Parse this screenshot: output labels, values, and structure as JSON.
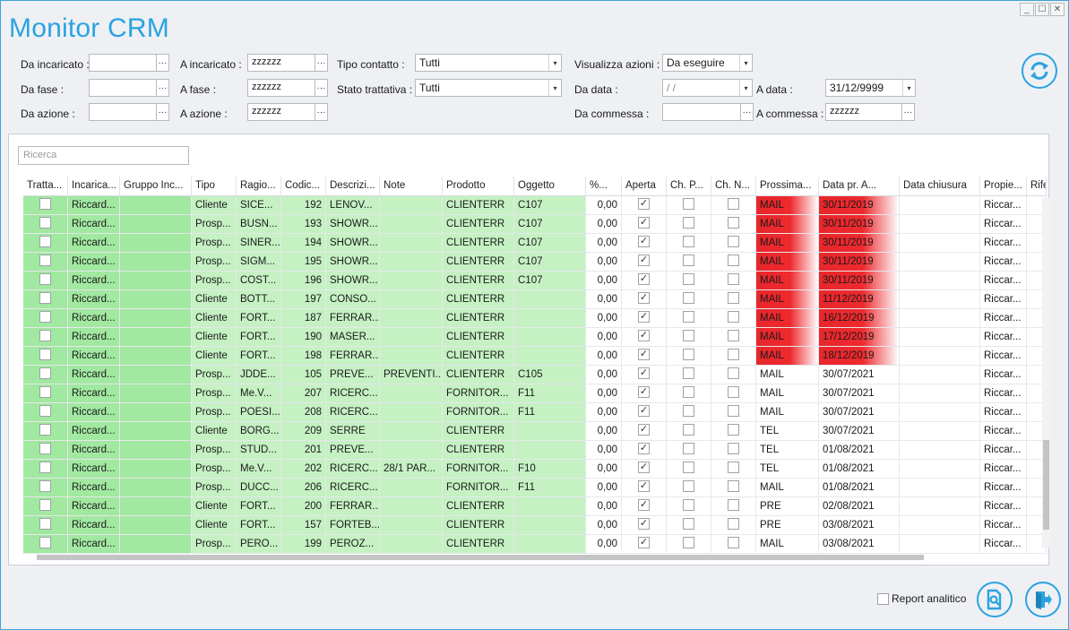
{
  "app": {
    "title": "Monitor CRM",
    "win_controls": [
      "_",
      "☐",
      "✕"
    ]
  },
  "filters": {
    "da_incaricato_label": "Da incaricato :",
    "a_incaricato_label": "A incaricato :",
    "a_incaricato_value": "zzzzzz",
    "tipo_contatto_label": "Tipo contatto :",
    "tipo_contatto_value": "Tutti",
    "visualizza_azioni_label": "Visualizza azioni :",
    "visualizza_azioni_value": "Da eseguire",
    "da_fase_label": "Da fase :",
    "a_fase_label": "A fase :",
    "a_fase_value": "zzzzzz",
    "stato_trattativa_label": "Stato trattativa :",
    "stato_trattativa_value": "Tutti",
    "da_data_label": "Da data :",
    "da_data_value": " / /",
    "a_data_label": "A data :",
    "a_data_value": "31/12/9999",
    "da_azione_label": "Da azione :",
    "a_azione_label": "A azione :",
    "a_azione_value": "zzzzzz",
    "da_commessa_label": "Da commessa :",
    "a_commessa_label": "A commessa :",
    "a_commessa_value": "zzzzzz",
    "ellipsis": "···",
    "dropdown_arrow": "▾"
  },
  "search": {
    "placeholder": "Ricerca"
  },
  "columns": [
    "Tratta...",
    "Incarica...",
    "Gruppo Inc...",
    "Tipo",
    "Ragio...",
    "Codic...",
    "Descrizi...",
    "Note",
    "Prodotto",
    "Oggetto",
    "%...",
    "Aperta",
    "Ch. P...",
    "Ch. N...",
    "Prossima...",
    "Data pr. A...",
    "Data chiusura",
    "Propie...",
    "Rife"
  ],
  "rows": [
    {
      "inc": "Riccard...",
      "tipo": "Cliente",
      "rag": "SICE...",
      "cod": "192",
      "desc": "LENOV...",
      "note": "",
      "prod": "CLIENTERR",
      "ogg": "C107",
      "perc": "0,00",
      "aperta": true,
      "pross": "MAIL",
      "data": "30/11/2019",
      "red": true,
      "prop": "Riccar..."
    },
    {
      "inc": "Riccard...",
      "tipo": "Prosp...",
      "rag": "BUSN...",
      "cod": "193",
      "desc": "SHOWR...",
      "note": "",
      "prod": "CLIENTERR",
      "ogg": "C107",
      "perc": "0,00",
      "aperta": true,
      "pross": "MAIL",
      "data": "30/11/2019",
      "red": true,
      "prop": "Riccar..."
    },
    {
      "inc": "Riccard...",
      "tipo": "Prosp...",
      "rag": "SINER...",
      "cod": "194",
      "desc": "SHOWR...",
      "note": "",
      "prod": "CLIENTERR",
      "ogg": "C107",
      "perc": "0,00",
      "aperta": true,
      "pross": "MAIL",
      "data": "30/11/2019",
      "red": true,
      "prop": "Riccar..."
    },
    {
      "inc": "Riccard...",
      "tipo": "Prosp...",
      "rag": "SIGM...",
      "cod": "195",
      "desc": "SHOWR...",
      "note": "",
      "prod": "CLIENTERR",
      "ogg": "C107",
      "perc": "0,00",
      "aperta": true,
      "pross": "MAIL",
      "data": "30/11/2019",
      "red": true,
      "prop": "Riccar..."
    },
    {
      "inc": "Riccard...",
      "tipo": "Prosp...",
      "rag": "COST...",
      "cod": "196",
      "desc": "SHOWR...",
      "note": "",
      "prod": "CLIENTERR",
      "ogg": "C107",
      "perc": "0,00",
      "aperta": true,
      "pross": "MAIL",
      "data": "30/11/2019",
      "red": true,
      "prop": "Riccar..."
    },
    {
      "inc": "Riccard...",
      "tipo": "Cliente",
      "rag": "BOTT...",
      "cod": "197",
      "desc": "CONSO...",
      "note": "",
      "prod": "CLIENTERR",
      "ogg": "",
      "perc": "0,00",
      "aperta": true,
      "pross": "MAIL",
      "data": "11/12/2019",
      "red": true,
      "prop": "Riccar..."
    },
    {
      "inc": "Riccard...",
      "tipo": "Cliente",
      "rag": "FORT...",
      "cod": "187",
      "desc": "FERRAR...",
      "note": "",
      "prod": "CLIENTERR",
      "ogg": "",
      "perc": "0,00",
      "aperta": true,
      "pross": "MAIL",
      "data": "16/12/2019",
      "red": true,
      "prop": "Riccar..."
    },
    {
      "inc": "Riccard...",
      "tipo": "Cliente",
      "rag": "FORT...",
      "cod": "190",
      "desc": "MASER...",
      "note": "",
      "prod": "CLIENTERR",
      "ogg": "",
      "perc": "0,00",
      "aperta": true,
      "pross": "MAIL",
      "data": "17/12/2019",
      "red": true,
      "prop": "Riccar..."
    },
    {
      "inc": "Riccard...",
      "tipo": "Cliente",
      "rag": "FORT...",
      "cod": "198",
      "desc": "FERRAR...",
      "note": "",
      "prod": "CLIENTERR",
      "ogg": "",
      "perc": "0,00",
      "aperta": true,
      "pross": "MAIL",
      "data": "18/12/2019",
      "red": true,
      "prop": "Riccar..."
    },
    {
      "inc": "Riccard...",
      "tipo": "Prosp...",
      "rag": "JDDE...",
      "cod": "105",
      "desc": "PREVE...",
      "note": "PREVENTI...",
      "prod": "CLIENTERR",
      "ogg": "C105",
      "perc": "0,00",
      "aperta": true,
      "pross": "MAIL",
      "data": "30/07/2021",
      "red": false,
      "prop": "Riccar..."
    },
    {
      "inc": "Riccard...",
      "tipo": "Prosp...",
      "rag": "Me.V...",
      "cod": "207",
      "desc": "RICERC...",
      "note": "",
      "prod": "FORNITOR...",
      "ogg": "F11",
      "perc": "0,00",
      "aperta": true,
      "pross": "MAIL",
      "data": "30/07/2021",
      "red": false,
      "prop": "Riccar..."
    },
    {
      "inc": "Riccard...",
      "tipo": "Prosp...",
      "rag": "POESI...",
      "cod": "208",
      "desc": "RICERC...",
      "note": "",
      "prod": "FORNITOR...",
      "ogg": "F11",
      "perc": "0,00",
      "aperta": true,
      "pross": "MAIL",
      "data": "30/07/2021",
      "red": false,
      "prop": "Riccar..."
    },
    {
      "inc": "Riccard...",
      "tipo": "Cliente",
      "rag": "BORG...",
      "cod": "209",
      "desc": "SERRE",
      "note": "",
      "prod": "CLIENTERR",
      "ogg": "",
      "perc": "0,00",
      "aperta": true,
      "pross": "TEL",
      "data": "30/07/2021",
      "red": false,
      "prop": "Riccar..."
    },
    {
      "inc": "Riccard...",
      "tipo": "Prosp...",
      "rag": "STUD...",
      "cod": "201",
      "desc": "PREVE...",
      "note": "",
      "prod": "CLIENTERR",
      "ogg": "",
      "perc": "0,00",
      "aperta": true,
      "pross": "TEL",
      "data": "01/08/2021",
      "red": false,
      "prop": "Riccar..."
    },
    {
      "inc": "Riccard...",
      "tipo": "Prosp...",
      "rag": "Me.V...",
      "cod": "202",
      "desc": "RICERC...",
      "note": "28/1 PAR...",
      "prod": "FORNITOR...",
      "ogg": "F10",
      "perc": "0,00",
      "aperta": true,
      "pross": "TEL",
      "data": "01/08/2021",
      "red": false,
      "prop": "Riccar..."
    },
    {
      "inc": "Riccard...",
      "tipo": "Prosp...",
      "rag": "DUCC...",
      "cod": "206",
      "desc": "RICERC...",
      "note": "",
      "prod": "FORNITOR...",
      "ogg": "F11",
      "perc": "0,00",
      "aperta": true,
      "pross": "MAIL",
      "data": "01/08/2021",
      "red": false,
      "prop": "Riccar..."
    },
    {
      "inc": "Riccard...",
      "tipo": "Cliente",
      "rag": "FORT...",
      "cod": "200",
      "desc": "FERRAR...",
      "note": "",
      "prod": "CLIENTERR",
      "ogg": "",
      "perc": "0,00",
      "aperta": true,
      "pross": "PRE",
      "data": "02/08/2021",
      "red": false,
      "prop": "Riccar..."
    },
    {
      "inc": "Riccard...",
      "tipo": "Cliente",
      "rag": "FORT...",
      "cod": "157",
      "desc": "FORTEB...",
      "note": "",
      "prod": "CLIENTERR",
      "ogg": "",
      "perc": "0,00",
      "aperta": true,
      "pross": "PRE",
      "data": "03/08/2021",
      "red": false,
      "prop": "Riccar..."
    },
    {
      "inc": "Riccard...",
      "tipo": "Prosp...",
      "rag": "PERO...",
      "cod": "199",
      "desc": "PEROZ...",
      "note": "",
      "prod": "CLIENTERR",
      "ogg": "",
      "perc": "0,00",
      "aperta": true,
      "pross": "MAIL",
      "data": "03/08/2021",
      "red": false,
      "prop": "Riccar..."
    }
  ],
  "footer": {
    "report_label": "Report analitico"
  },
  "colors": {
    "accent": "#2aa3e0",
    "green": "#a1e8a0",
    "green_light": "#c5f1c3",
    "alert_red": "#e8262b"
  }
}
